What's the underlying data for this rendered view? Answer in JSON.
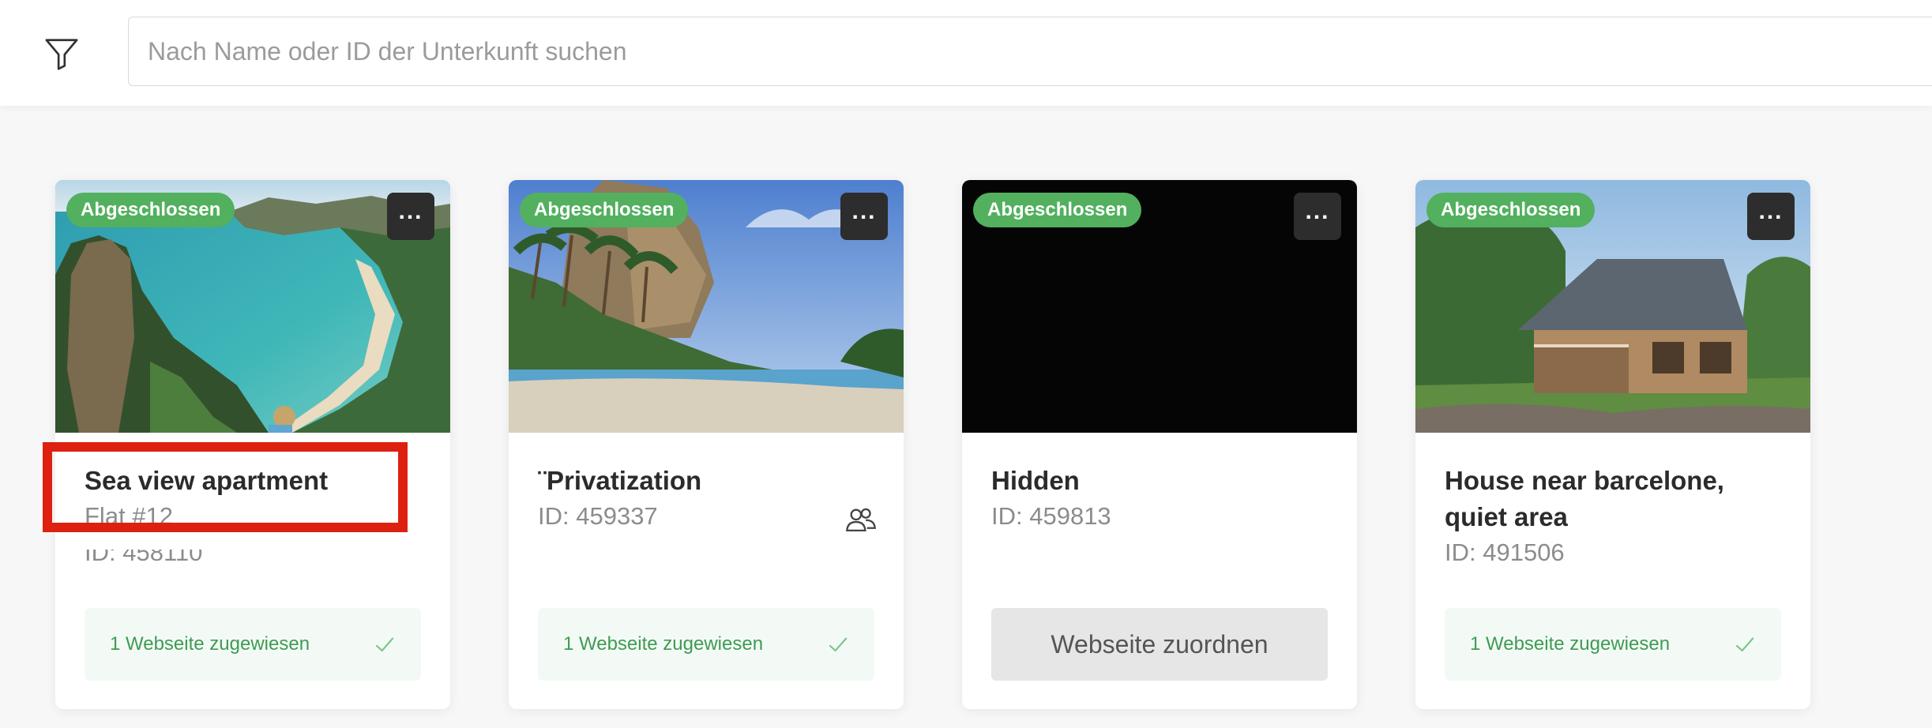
{
  "search": {
    "placeholder": "Nach Name oder ID der Unterkunft suchen"
  },
  "icons": {
    "filter": "filter-icon",
    "more": "more-options-icon",
    "check": "check-icon",
    "people": "users-icon"
  },
  "colors": {
    "badge": "#52b05f",
    "assigned_text": "#3f9b52",
    "highlight": "#dd2010"
  },
  "cards": [
    {
      "status": "Abgeschlossen",
      "more_label": "...",
      "title": "Sea view apartment",
      "subtitle": "Flat #12",
      "id_label": "ID: 458110",
      "assignment": "1 Webseite zugewiesen"
    },
    {
      "status": "Abgeschlossen",
      "more_label": "...",
      "title": "¨Privatization",
      "id_label": "ID: 459337",
      "assignment": "1 Webseite zugewiesen"
    },
    {
      "status": "Abgeschlossen",
      "more_label": "...",
      "title": "Hidden",
      "id_label": "ID: 459813",
      "assign_button": "Webseite zuordnen"
    },
    {
      "status": "Abgeschlossen",
      "more_label": "...",
      "title": "House near barcelone, quiet area",
      "id_label": "ID: 491506",
      "assignment": "1 Webseite zugewiesen"
    }
  ]
}
